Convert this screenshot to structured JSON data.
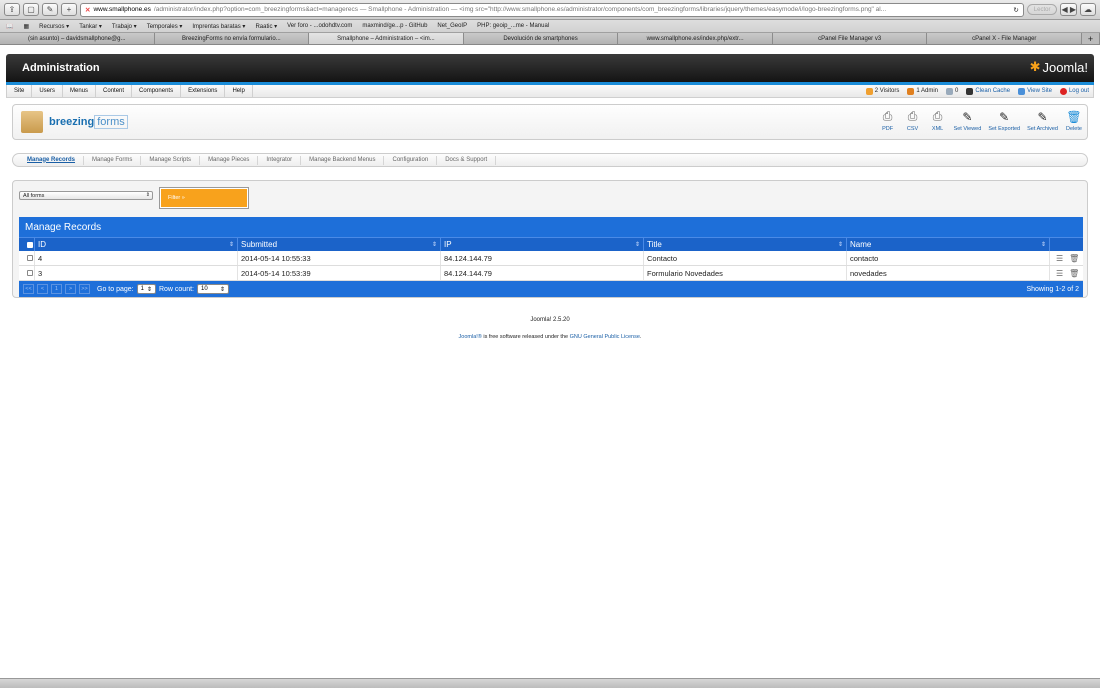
{
  "browser": {
    "url_domain": "www.smallphone.es",
    "url_rest": "/administrator/index.php?option=com_breezingforms&act=managerecs — Smallphone - Administration — <img src=\"http://www.smallphone.es/administrator/components/com_breezingforms/libraries/jquery/themes/easymode/i/logo-breezingforms.png\" al...",
    "reader_label": "Lector",
    "bookmarks": [
      "Recursos ▾",
      "Tankar ▾",
      "Trabajo ▾",
      "Temporales ▾",
      "Imprentas baratas ▾",
      "Raatic ▾",
      "Ver foro - ...odohdtv.com",
      "maxmind/ge...p - GitHub",
      "Net_GeoIP",
      "PHP: geoip_...me - Manual"
    ],
    "tabs": [
      "(sin asunto) – davidsmallphone@g...",
      "BreezingForms no envía formulario...",
      "Smallphone – Administration – <im...",
      "Devolución de smartphones",
      "www.smallphone.es/index.php/extr...",
      "cPanel File Manager v3",
      "cPanel X - File Manager"
    ]
  },
  "header": {
    "title": "Administration",
    "brand": "Joomla!"
  },
  "menubar": {
    "items": [
      "Site",
      "Users",
      "Menus",
      "Content",
      "Components",
      "Extensions",
      "Help"
    ],
    "status": {
      "visitors": "2 Visitors",
      "admin": "1 Admin",
      "messages": "0",
      "clean_cache": "Clean Cache",
      "view_site": "View Site",
      "logout": "Log out"
    }
  },
  "component": {
    "logo_text": "breezing",
    "logo_suffix": "forms",
    "toolbar": [
      "PDF",
      "CSV",
      "XML",
      "Set Viewed",
      "Set Exported",
      "Set Archived",
      "Delete"
    ]
  },
  "subtabs": [
    "Manage Records",
    "Manage Forms",
    "Manage Scripts",
    "Manage Pieces",
    "Integrator",
    "Manage Backend Menus",
    "Configuration",
    "Docs & Support"
  ],
  "filter": {
    "select_value": "All forms",
    "button_label": "Filter »"
  },
  "grid": {
    "title": "Manage Records",
    "columns": [
      "ID",
      "Submitted",
      "IP",
      "Title",
      "Name"
    ],
    "rows": [
      {
        "id": "4",
        "submitted": "2014-05-14 10:55:33",
        "ip": "84.124.144.79",
        "title": "Contacto",
        "name": "contacto"
      },
      {
        "id": "3",
        "submitted": "2014-05-14 10:53:39",
        "ip": "84.124.144.79",
        "title": "Formulario Novedades",
        "name": "novedades"
      }
    ],
    "pager": [
      "<<",
      "<",
      "1",
      ">",
      ">>"
    ],
    "goto_label": "Go to page:",
    "goto_value": "1",
    "rowcount_label": "Row count:",
    "rowcount_value": "10",
    "showing": "Showing 1-2 of 2"
  },
  "footer": {
    "version": "Joomla! 2.5.20",
    "license_link": "Joomla!®",
    "license_text": " is free software released under the ",
    "license_name": "GNU General Public License",
    "license_end": "."
  }
}
